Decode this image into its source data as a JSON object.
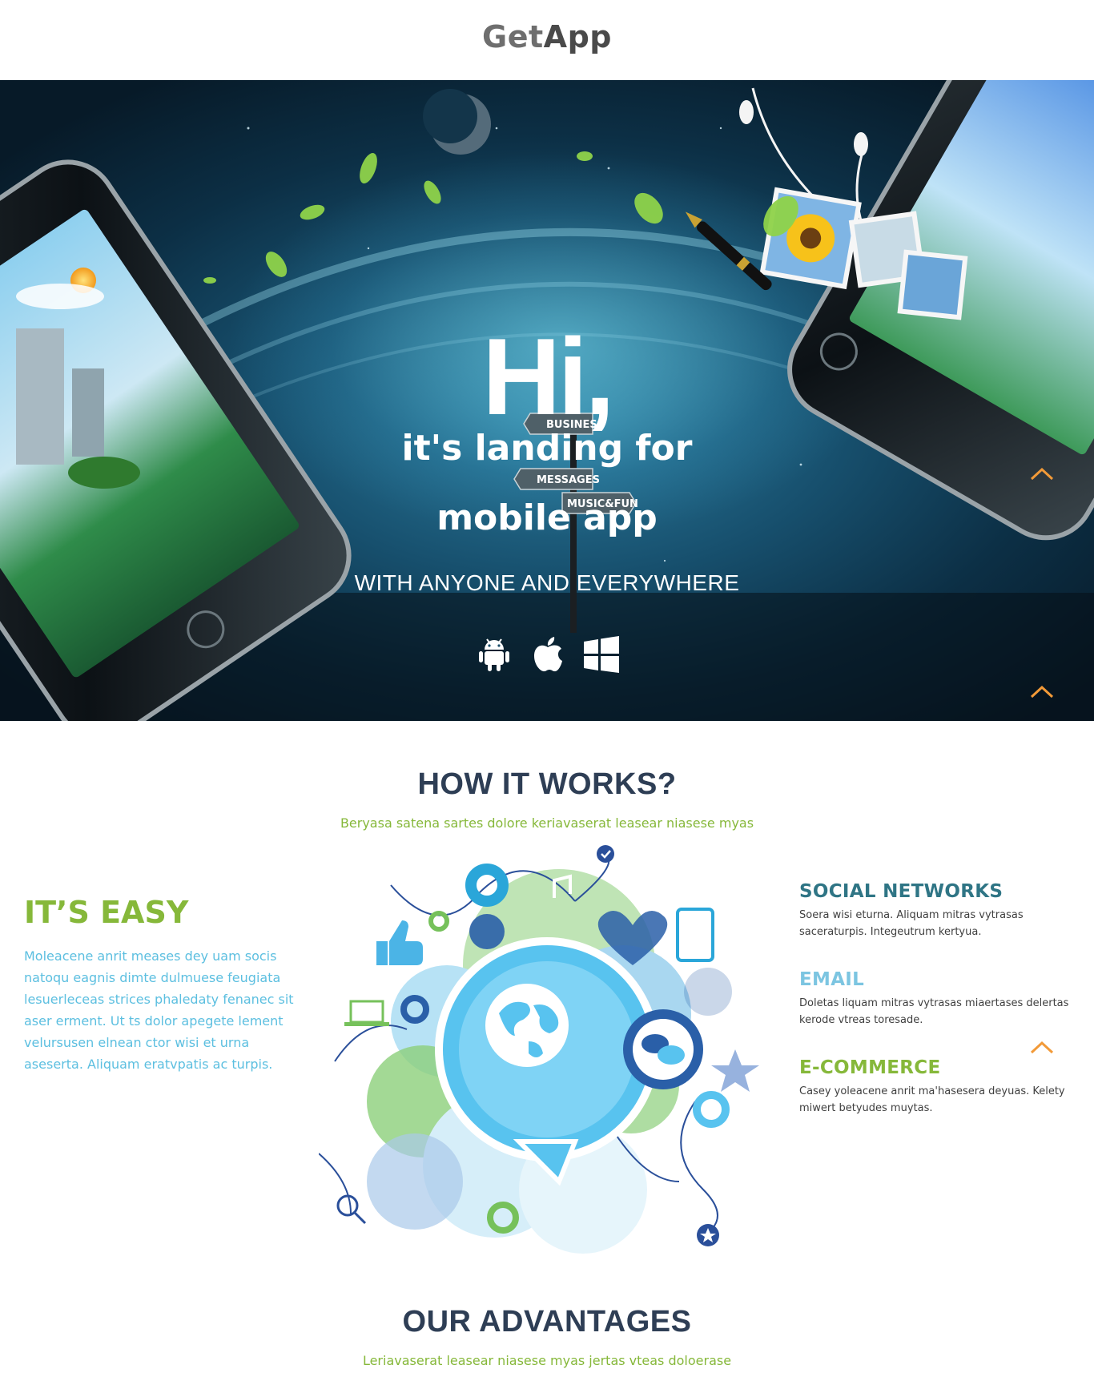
{
  "header": {
    "logo_part1": "Get",
    "logo_part2": "App"
  },
  "hero": {
    "title": "Hi,",
    "subtitle_line1": "it's landing for",
    "subtitle_line2": "mobile app",
    "tagline": "WITH ANYONE AND EVERYWHERE",
    "signpost": [
      "BUSINESS",
      "MESSAGES",
      "MUSIC&FUN"
    ],
    "platforms": [
      "android-icon",
      "apple-icon",
      "windows-icon"
    ],
    "scroll_up_icon": "chevron-up-icon",
    "accent_color": "#f29a38"
  },
  "how_it_works": {
    "title": "HOW IT WORKS?",
    "subtitle": "Beryasa satena sartes dolore keriavaserat leasear niasese myas",
    "easy": {
      "title": "IT’S EASY",
      "text": "Moleacene anrit meases dey uam socis natoqu eagnis dimte dulmuese feugiata lesuerleceas strices phaledaty fenanec sit aser erment. Ut ts dolor apegete lement velursusen elnean ctor wisi et urna aseserta. Aliquam eratvpatis ac turpis."
    },
    "features": [
      {
        "title": "SOCIAL NETWORKS",
        "text": "Soera wisi eturna. Aliquam mitras vytrasas saceraturpis. Integeutrum kertyua.",
        "color": "#2f7585"
      },
      {
        "title": "EMAIL",
        "text": "Doletas liquam mitras vytrasas miaertases delertas kerode vtreas toresade.",
        "color": "#7cc5e1"
      },
      {
        "title": "E-COMMERCE",
        "text": "Casey yoleacene anrit ma'hasesera deyuas. Kelety miwert betyudes muytas.",
        "color": "#86b83a"
      }
    ]
  },
  "advantages": {
    "title": "OUR ADVANTAGES",
    "subtitle": "Leriavaserat leasear niasese myas jertas vteas doloerase"
  },
  "colors": {
    "title_dark": "#2e3e55",
    "green": "#86b83a",
    "blue_text": "#5cbfe0",
    "teal": "#2f7585"
  }
}
